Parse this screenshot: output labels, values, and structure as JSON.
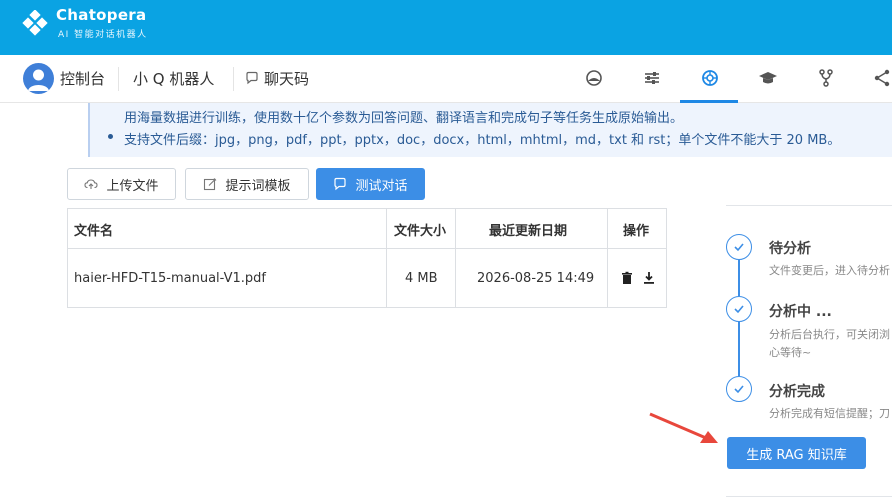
{
  "brand": {
    "name": "Chatopera",
    "subtitle": "AI 智能对话机器人"
  },
  "nav": {
    "console": "控制台",
    "bot_name": "小 Q 机器人",
    "chat_code": "聊天码",
    "icons": [
      "dashboard-icon",
      "sliders-icon",
      "knowledge-icon",
      "graduation-cap-icon",
      "git-fork-icon",
      "share-icon"
    ],
    "active_index": 2,
    "accent_color": "#1e88e5"
  },
  "note": {
    "line1": "用海量数据进行训练，使用数十亿个参数为回答问题、翻译语言和完成句子等任务生成原始输出。",
    "line2": "支持文件后缀：jpg，png，pdf，ppt，pptx，doc，docx，html，mhtml，md，txt 和 rst；单个文件不能大于 20 MB。"
  },
  "toolbar": {
    "upload_label": "上传文件",
    "prompt_label": "提示词模板",
    "test_label": "测试对话"
  },
  "table": {
    "headers": [
      "文件名",
      "文件大小",
      "最近更新日期",
      "操作"
    ],
    "rows": [
      {
        "name": "haier-HFD-T15-manual-V1.pdf",
        "size": "4 MB",
        "updated": "2026-08-25 14:49"
      }
    ]
  },
  "steps": [
    {
      "title": "待分析",
      "desc": [
        "文件变更后，进入待分析"
      ]
    },
    {
      "title": "分析中 ...",
      "desc": [
        "分析后台执行，可关闭浏",
        "心等待~"
      ]
    },
    {
      "title": "分析完成",
      "desc": [
        "分析完成有短信提醒；刀"
      ]
    }
  ],
  "rag_button": "生成 RAG 知识库",
  "colors": {
    "topbar": "#0aa3e3",
    "primary": "#3c8ee6",
    "note_bg": "#eef4fd",
    "arrow": "#e8473c"
  }
}
